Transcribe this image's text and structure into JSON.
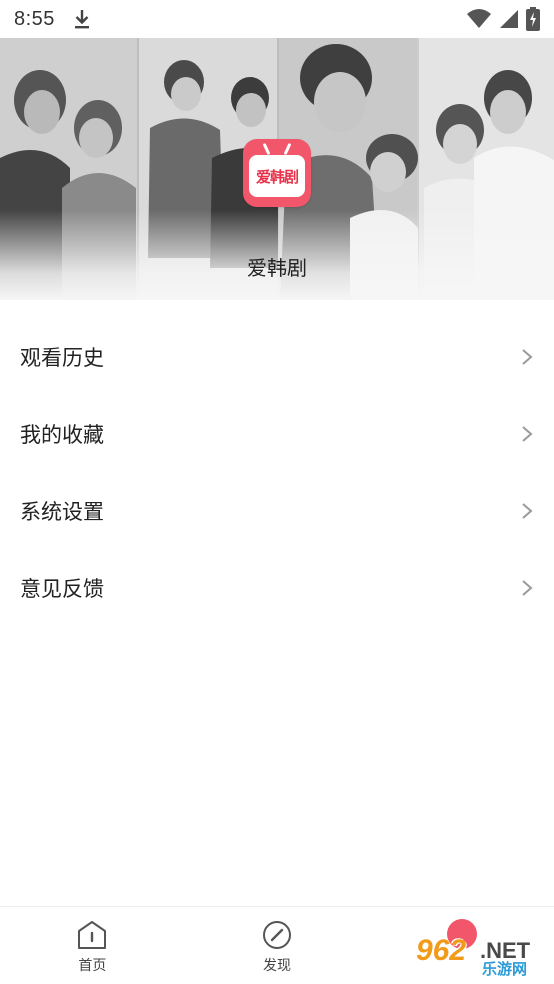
{
  "status_bar": {
    "time": "8:55",
    "icons": [
      "download-icon",
      "wifi-icon",
      "signal-icon",
      "battery-charging-icon"
    ]
  },
  "banner": {
    "app_name": "爱韩剧",
    "logo_text": "爱韩剧",
    "logo_color": "#f2566a"
  },
  "menu": {
    "items": [
      {
        "label": "观看历史",
        "icon": "chevron-right-icon"
      },
      {
        "label": "我的收藏",
        "icon": "chevron-right-icon"
      },
      {
        "label": "系统设置",
        "icon": "chevron-right-icon"
      },
      {
        "label": "意见反馈",
        "icon": "chevron-right-icon"
      }
    ]
  },
  "tab_bar": {
    "tabs": [
      {
        "label": "首页",
        "icon": "home-icon"
      },
      {
        "label": "发现",
        "icon": "compass-icon"
      },
      {
        "label": "",
        "icon": "profile-icon"
      }
    ]
  },
  "watermark": {
    "logo": "962",
    "suffix": ".NET",
    "site": "乐游网"
  }
}
